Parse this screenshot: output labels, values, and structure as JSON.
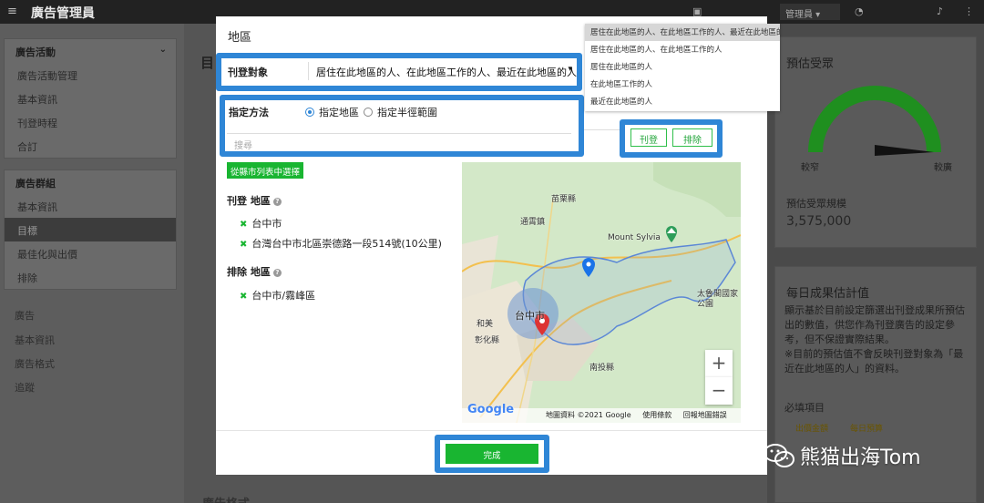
{
  "topbar": {
    "title": "廣告管理員",
    "account": "管理員 ▾"
  },
  "sidebar": {
    "group1": {
      "head": "廣告活動",
      "items": [
        "廣告活動管理",
        "基本資訊",
        "刊登時程",
        "合訂"
      ]
    },
    "group2": {
      "head": "廣告群組",
      "items": [
        "基本資訊",
        "目標",
        "最佳化與出價",
        "排除"
      ]
    },
    "loose": [
      "廣告",
      "基本資訊",
      "廣告格式",
      "追蹤"
    ]
  },
  "main": {
    "heading": "目",
    "bottom_heading": "廣告格式"
  },
  "right_panel": {
    "audience_title": "預估受眾",
    "gauge_left": "較窄",
    "gauge_right": "較廣",
    "reach_label": "預估受眾規模",
    "reach_value": "3,575,000",
    "daily_title": "每日成果估計值",
    "daily_body": "顯示基於目前設定篩選出刊登成果所預估出的數值，供您作為刊登廣告的設定參考，但不保證實際結果。",
    "daily_note": "※目前的預估值不會反映刊登對象為「最近在此地區的人」的資料。",
    "required_label": "必填項目",
    "tags": [
      "出價金額",
      "每日預算"
    ]
  },
  "dropdown": {
    "options": [
      "居住在此地區的人、在此地區工作的人、最近在此地區的人",
      "居住在此地區的人、在此地區工作的人",
      "居住在此地區的人",
      "在此地區工作的人",
      "最近在此地區的人"
    ],
    "selected_index": 0
  },
  "modal": {
    "title": "地區",
    "target_label": "刊登對象",
    "target_value": "居住在此地區的人、在此地區工作的人、最近在此地區的人",
    "method_label": "指定方法",
    "method_options": [
      "指定地區",
      "指定半徑範圍"
    ],
    "method_selected": 0,
    "search_placeholder": "搜尋",
    "include_button": "刊登",
    "exclude_button": "排除",
    "select_from_list": "從縣市列表中選擇",
    "include_section": "刊登 地區",
    "include_items": [
      "台中市",
      "台灣台中市北區崇德路一段514號(10公里)"
    ],
    "exclude_section": "排除 地區",
    "exclude_items": [
      "台中市/霧峰區"
    ],
    "done_button": "完成"
  },
  "map": {
    "labels": {
      "city": "台中市",
      "shanxian": "苗栗縣",
      "tong": "通霄鎮",
      "mount": "Mount Sylvia",
      "heping": "和美",
      "changhua": "彰化縣",
      "nantou": "南投縣",
      "taroko": "太魯閣國家公園"
    },
    "attribution": "地圖資料 ©2021 Google",
    "terms": "使用條款",
    "report": "回報地圖錯誤",
    "google": "Google",
    "zoom_in": "+",
    "zoom_out": "−"
  },
  "watermark": {
    "text": "熊猫出海Tom"
  },
  "colors": {
    "highlight": "#2f86d6",
    "green": "#19b531",
    "gauge": "#1f8f1f"
  }
}
